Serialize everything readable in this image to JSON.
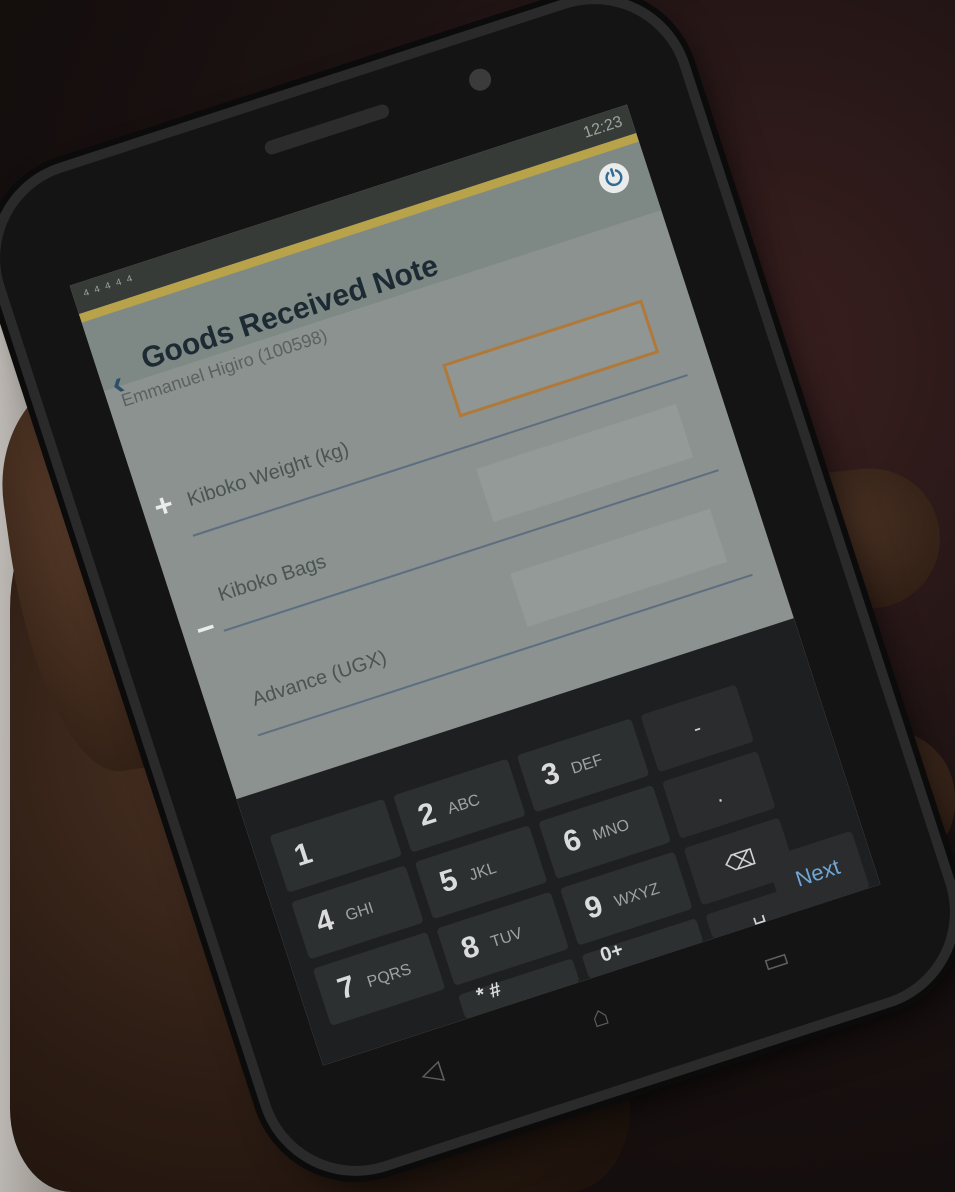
{
  "app": {
    "title": "Goods Received Note",
    "subtitle": "Emmanuel Higiro (100598)",
    "status_left": "⁴ ⁴ ⁴ ⁴ ⁴",
    "status_right": "12:23"
  },
  "form": {
    "fields": [
      {
        "label": "Kiboko Weight (kg)"
      },
      {
        "label": "Kiboko Bags"
      },
      {
        "label": "Advance (UGX)"
      }
    ]
  },
  "keyboard": {
    "keys": [
      {
        "digit": "1",
        "letters": ""
      },
      {
        "digit": "2",
        "letters": "ABC"
      },
      {
        "digit": "3",
        "letters": "DEF"
      },
      {
        "digit": "4",
        "letters": "GHI"
      },
      {
        "digit": "5",
        "letters": "JKL"
      },
      {
        "digit": "6",
        "letters": "MNO"
      },
      {
        "digit": "7",
        "letters": "PQRS"
      },
      {
        "digit": "8",
        "letters": "TUV"
      },
      {
        "digit": "9",
        "letters": "WXYZ"
      },
      {
        "digit": "* #",
        "letters": ""
      },
      {
        "digit": "0+",
        "letters": ""
      }
    ],
    "side": {
      "dash": "-",
      "dot": ".",
      "backspace": "⌫",
      "next": "Next",
      "space": "␣"
    }
  },
  "icons": {
    "back": "chevron-left-icon",
    "power": "power-icon",
    "plus": "plus-icon",
    "minus": "minus-icon"
  },
  "colors": {
    "accent": "#b8a24a",
    "title": "#1c2b33",
    "input_border": "#b0793a"
  }
}
